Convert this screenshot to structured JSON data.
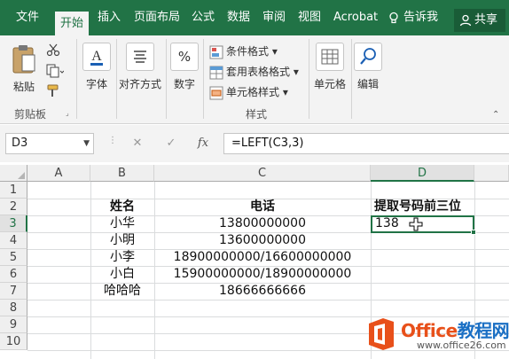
{
  "tabs": [
    {
      "label": "文件",
      "active": false
    },
    {
      "label": "开始",
      "active": true
    },
    {
      "label": "插入",
      "active": false
    },
    {
      "label": "页面布局",
      "active": false
    },
    {
      "label": "公式",
      "active": false
    },
    {
      "label": "数据",
      "active": false
    },
    {
      "label": "审阅",
      "active": false
    },
    {
      "label": "视图",
      "active": false
    },
    {
      "label": "Acrobat",
      "active": false
    }
  ],
  "tell_me": "告诉我",
  "share": "共享",
  "ribbon": {
    "paste": "粘贴",
    "clipboard_group": "剪贴板",
    "font": "字体",
    "alignment": "对齐方式",
    "number": "数字",
    "conditional_format": "条件格式",
    "table_format": "套用表格格式",
    "cell_style": "单元格样式",
    "styles_group": "样式",
    "cells": "单元格",
    "editing": "编辑"
  },
  "formula_bar": {
    "name_box": "D3",
    "cancel_symbol": "✕",
    "enter_symbol": "✓",
    "fx_symbol": "fx",
    "formula": "=LEFT(C3,3)"
  },
  "grid": {
    "columns": [
      "A",
      "B",
      "C",
      "D"
    ],
    "rows": [
      "1",
      "2",
      "3",
      "4",
      "5",
      "6",
      "7",
      "8",
      "9",
      "10"
    ],
    "selected_cell": "D3",
    "cells": {
      "B2": "姓名",
      "C2": "电话",
      "D2": "提取号码前三位",
      "B3": "小华",
      "C3": "13800000000",
      "D3": "138",
      "B4": "小明",
      "C4": "13600000000",
      "B5": "小李",
      "C5": "18900000000/16600000000",
      "B6": "小白",
      "C6": "15900000000/18900000000",
      "B7": "哈哈哈",
      "C7": "18666666666"
    }
  },
  "watermark": {
    "title_latin": "Office",
    "title_cn": "教程网",
    "url": "www.office26.com"
  },
  "colors": {
    "excel_green": "#217346",
    "ribbon_bg": "#f3f3f3",
    "watermark_orange": "#e8501a",
    "watermark_blue": "#1a6fc4"
  }
}
